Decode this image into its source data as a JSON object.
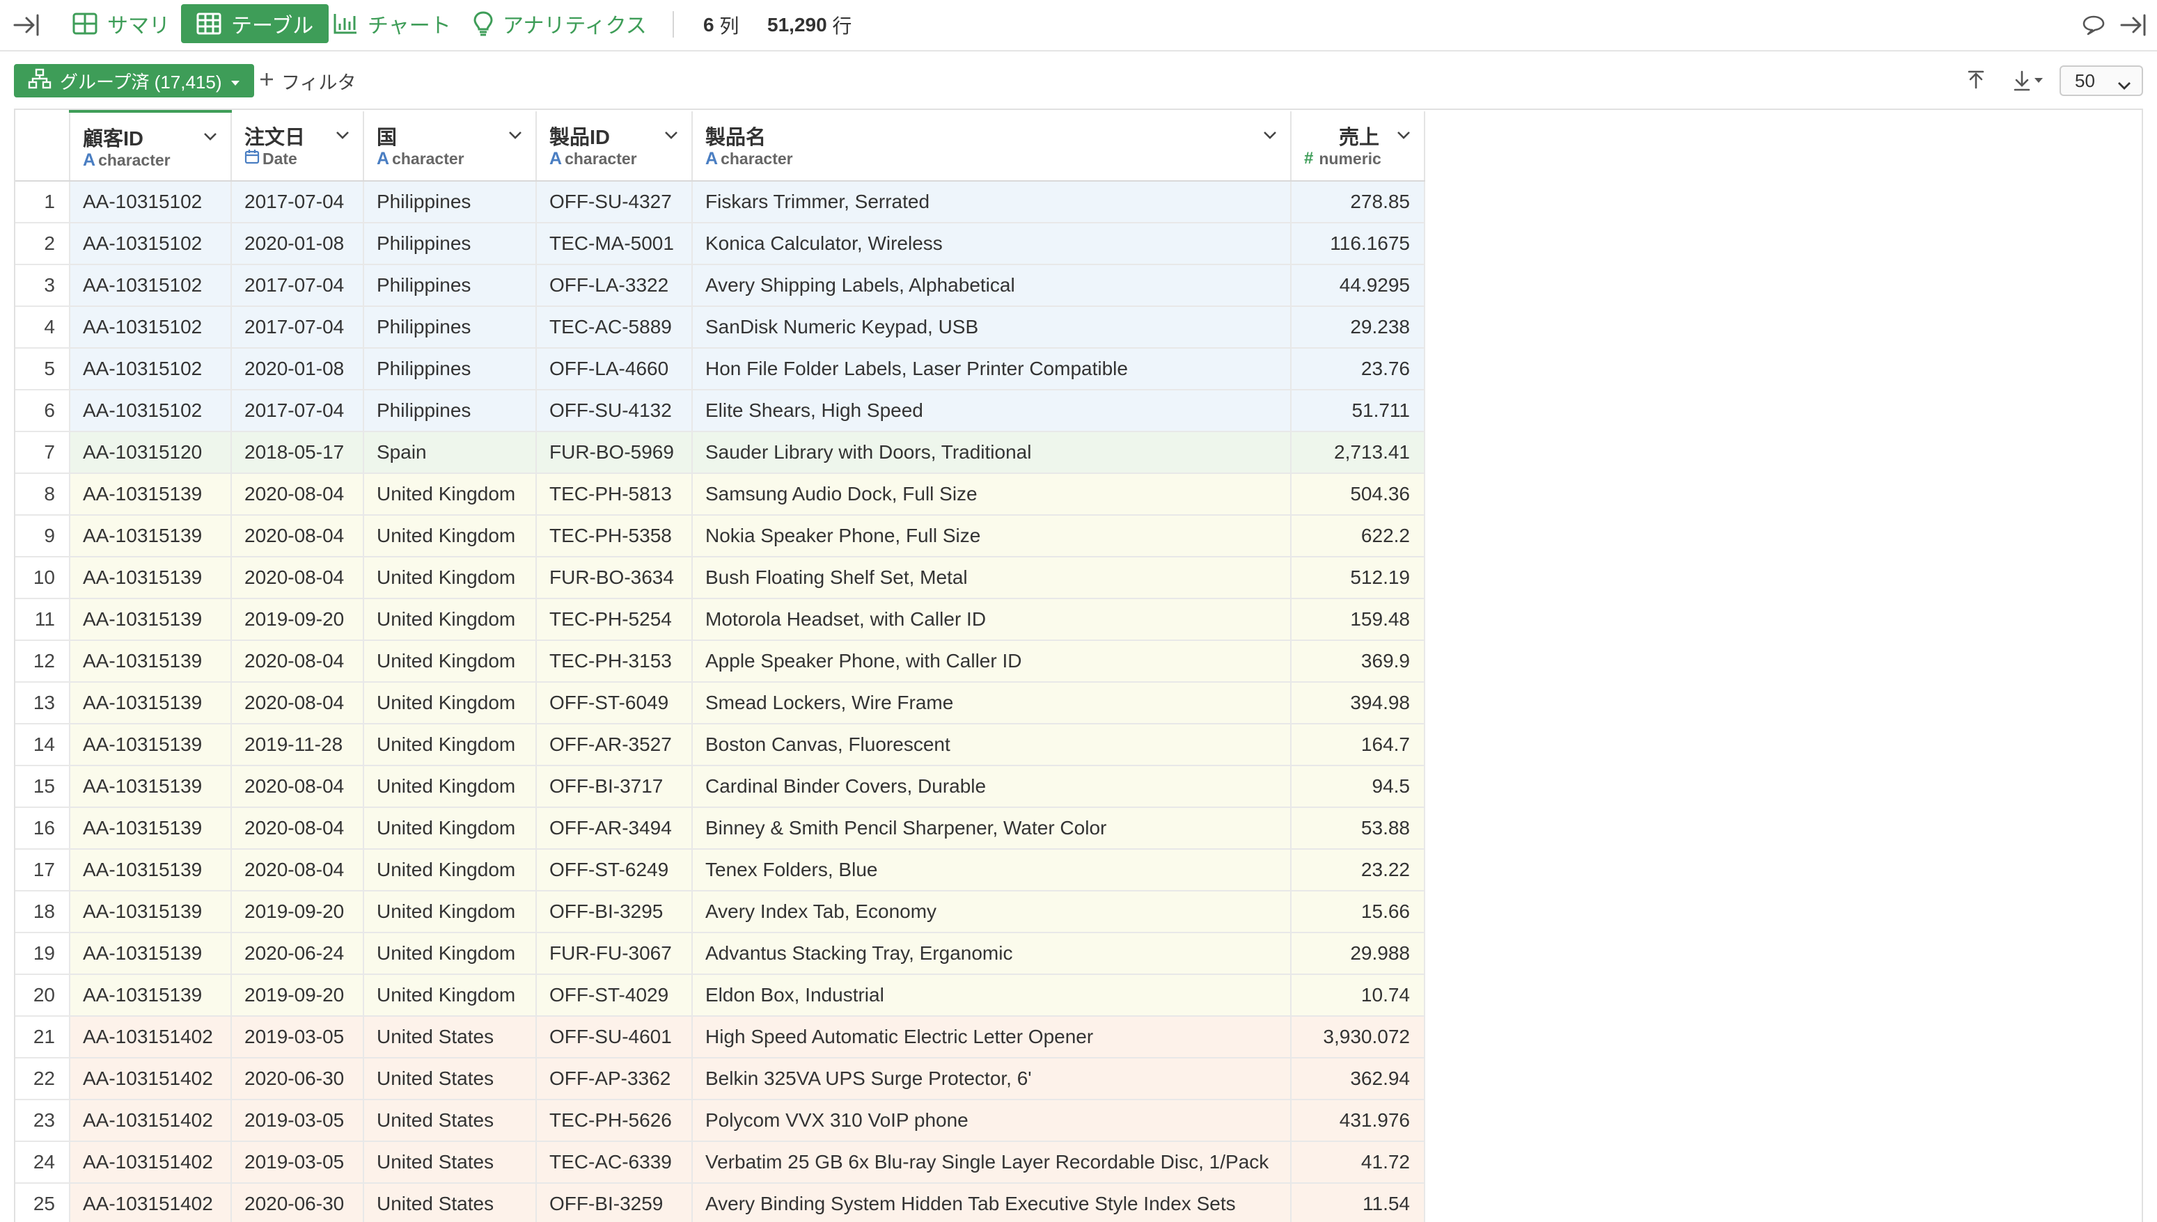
{
  "topbar": {
    "tabs": [
      {
        "label": "サマリ",
        "icon": "summary-grid-icon"
      },
      {
        "label": "テーブル",
        "icon": "table-icon"
      },
      {
        "label": "チャート",
        "icon": "bar-chart-icon"
      },
      {
        "label": "アナリティクス",
        "icon": "lightbulb-icon"
      }
    ],
    "active_tab": "テーブル",
    "columns_count": "6",
    "columns_unit": "列",
    "rows_count": "51,290",
    "rows_unit": "行"
  },
  "toolbar": {
    "group_label": "グループ済 (17,415)",
    "filter_label": "フィルタ",
    "page_size": "50"
  },
  "table": {
    "columns": [
      {
        "name": "顧客ID",
        "type": "character",
        "type_icon": "A"
      },
      {
        "name": "注文日",
        "type": "Date",
        "type_icon": "calendar"
      },
      {
        "name": "国",
        "type": "character",
        "type_icon": "A"
      },
      {
        "name": "製品ID",
        "type": "character",
        "type_icon": "A"
      },
      {
        "name": "製品名",
        "type": "character",
        "type_icon": "A"
      },
      {
        "name": "売上",
        "type": "numeric",
        "type_icon": "#"
      }
    ],
    "rows": [
      {
        "n": "1",
        "group": 1,
        "cells": [
          "AA-10315102",
          "2017-07-04",
          "Philippines",
          "OFF-SU-4327",
          "Fiskars Trimmer, Serrated",
          "278.85"
        ]
      },
      {
        "n": "2",
        "group": 1,
        "cells": [
          "AA-10315102",
          "2020-01-08",
          "Philippines",
          "TEC-MA-5001",
          "Konica Calculator, Wireless",
          "116.1675"
        ]
      },
      {
        "n": "3",
        "group": 1,
        "cells": [
          "AA-10315102",
          "2017-07-04",
          "Philippines",
          "OFF-LA-3322",
          "Avery Shipping Labels, Alphabetical",
          "44.9295"
        ]
      },
      {
        "n": "4",
        "group": 1,
        "cells": [
          "AA-10315102",
          "2017-07-04",
          "Philippines",
          "TEC-AC-5889",
          "SanDisk Numeric Keypad, USB",
          "29.238"
        ]
      },
      {
        "n": "5",
        "group": 1,
        "cells": [
          "AA-10315102",
          "2020-01-08",
          "Philippines",
          "OFF-LA-4660",
          "Hon File Folder Labels, Laser Printer Compatible",
          "23.76"
        ]
      },
      {
        "n": "6",
        "group": 1,
        "cells": [
          "AA-10315102",
          "2017-07-04",
          "Philippines",
          "OFF-SU-4132",
          "Elite Shears, High Speed",
          "51.711"
        ]
      },
      {
        "n": "7",
        "group": 2,
        "cells": [
          "AA-10315120",
          "2018-05-17",
          "Spain",
          "FUR-BO-5969",
          "Sauder Library with Doors, Traditional",
          "2,713.41"
        ]
      },
      {
        "n": "8",
        "group": 3,
        "cells": [
          "AA-10315139",
          "2020-08-04",
          "United Kingdom",
          "TEC-PH-5813",
          "Samsung Audio Dock, Full Size",
          "504.36"
        ]
      },
      {
        "n": "9",
        "group": 3,
        "cells": [
          "AA-10315139",
          "2020-08-04",
          "United Kingdom",
          "TEC-PH-5358",
          "Nokia Speaker Phone, Full Size",
          "622.2"
        ]
      },
      {
        "n": "10",
        "group": 3,
        "cells": [
          "AA-10315139",
          "2020-08-04",
          "United Kingdom",
          "FUR-BO-3634",
          "Bush Floating Shelf Set, Metal",
          "512.19"
        ]
      },
      {
        "n": "11",
        "group": 3,
        "cells": [
          "AA-10315139",
          "2019-09-20",
          "United Kingdom",
          "TEC-PH-5254",
          "Motorola Headset, with Caller ID",
          "159.48"
        ]
      },
      {
        "n": "12",
        "group": 3,
        "cells": [
          "AA-10315139",
          "2020-08-04",
          "United Kingdom",
          "TEC-PH-3153",
          "Apple Speaker Phone, with Caller ID",
          "369.9"
        ]
      },
      {
        "n": "13",
        "group": 3,
        "cells": [
          "AA-10315139",
          "2020-08-04",
          "United Kingdom",
          "OFF-ST-6049",
          "Smead Lockers, Wire Frame",
          "394.98"
        ]
      },
      {
        "n": "14",
        "group": 3,
        "cells": [
          "AA-10315139",
          "2019-11-28",
          "United Kingdom",
          "OFF-AR-3527",
          "Boston Canvas, Fluorescent",
          "164.7"
        ]
      },
      {
        "n": "15",
        "group": 3,
        "cells": [
          "AA-10315139",
          "2020-08-04",
          "United Kingdom",
          "OFF-BI-3717",
          "Cardinal Binder Covers, Durable",
          "94.5"
        ]
      },
      {
        "n": "16",
        "group": 3,
        "cells": [
          "AA-10315139",
          "2020-08-04",
          "United Kingdom",
          "OFF-AR-3494",
          "Binney & Smith Pencil Sharpener, Water Color",
          "53.88"
        ]
      },
      {
        "n": "17",
        "group": 3,
        "cells": [
          "AA-10315139",
          "2020-08-04",
          "United Kingdom",
          "OFF-ST-6249",
          "Tenex Folders, Blue",
          "23.22"
        ]
      },
      {
        "n": "18",
        "group": 3,
        "cells": [
          "AA-10315139",
          "2019-09-20",
          "United Kingdom",
          "OFF-BI-3295",
          "Avery Index Tab, Economy",
          "15.66"
        ]
      },
      {
        "n": "19",
        "group": 3,
        "cells": [
          "AA-10315139",
          "2020-06-24",
          "United Kingdom",
          "FUR-FU-3067",
          "Advantus Stacking Tray, Erganomic",
          "29.988"
        ]
      },
      {
        "n": "20",
        "group": 3,
        "cells": [
          "AA-10315139",
          "2019-09-20",
          "United Kingdom",
          "OFF-ST-4029",
          "Eldon Box, Industrial",
          "10.74"
        ]
      },
      {
        "n": "21",
        "group": 4,
        "cells": [
          "AA-103151402",
          "2019-03-05",
          "United States",
          "OFF-SU-4601",
          "High Speed Automatic Electric Letter Opener",
          "3,930.072"
        ]
      },
      {
        "n": "22",
        "group": 4,
        "cells": [
          "AA-103151402",
          "2020-06-30",
          "United States",
          "OFF-AP-3362",
          "Belkin 325VA UPS Surge Protector, 6'",
          "362.94"
        ]
      },
      {
        "n": "23",
        "group": 4,
        "cells": [
          "AA-103151402",
          "2019-03-05",
          "United States",
          "TEC-PH-5626",
          "Polycom VVX 310 VoIP phone",
          "431.976"
        ]
      },
      {
        "n": "24",
        "group": 4,
        "cells": [
          "AA-103151402",
          "2019-03-05",
          "United States",
          "TEC-AC-6339",
          "Verbatim 25 GB 6x Blu-ray Single Layer Recordable Disc, 1/Pack",
          "41.72"
        ]
      },
      {
        "n": "25",
        "group": 4,
        "cells": [
          "AA-103151402",
          "2020-06-30",
          "United States",
          "OFF-BI-3259",
          "Avery Binding System Hidden Tab Executive Style Index Sets",
          "11.54"
        ]
      }
    ]
  },
  "colors": {
    "accent": "#3e9d58",
    "group_1": "#eef5fb",
    "group_2": "#eef6ec",
    "group_3": "#fbfbec",
    "group_4": "#fdf2ea"
  }
}
